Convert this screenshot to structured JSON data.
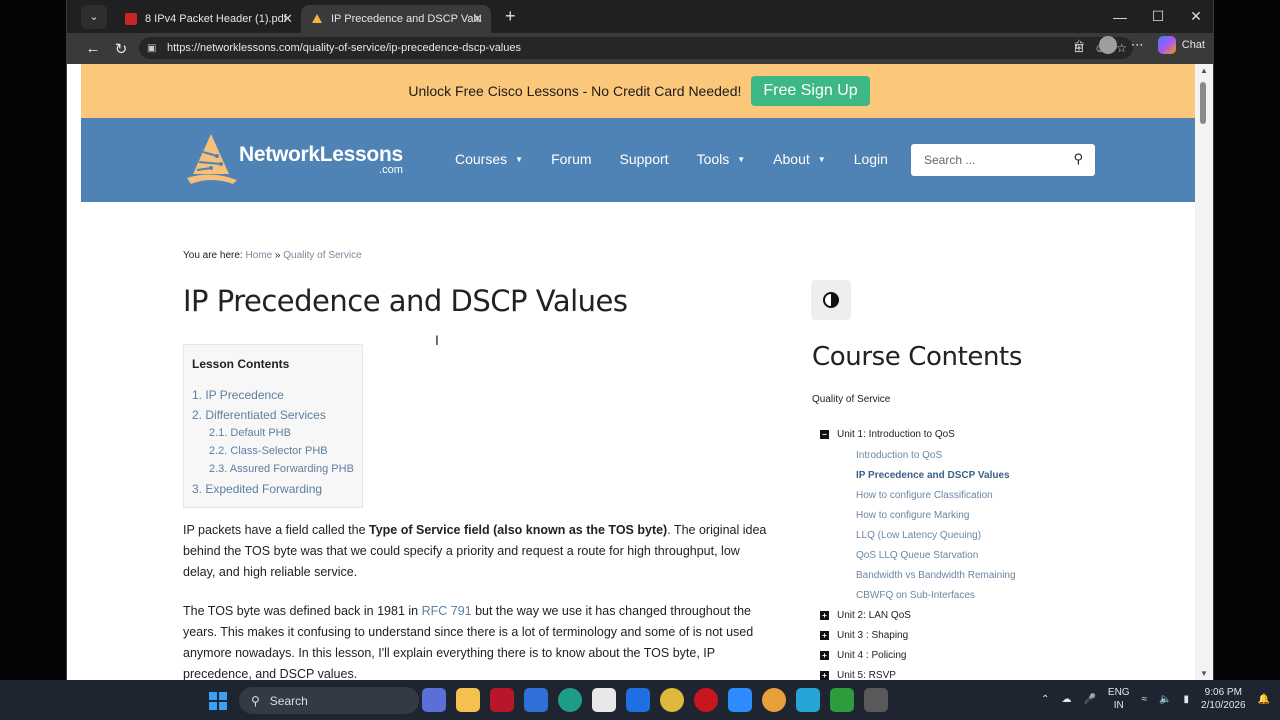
{
  "browser": {
    "tabs": [
      {
        "label": "8 IPv4 Packet Header (1).pdf"
      },
      {
        "label": "IP Precedence and DSCP Values"
      }
    ],
    "url": "https://networklessons.com/quality-of-service/ip-precedence-dscp-values",
    "chat_label": "Chat"
  },
  "promo": {
    "text": "Unlock Free Cisco Lessons - No Credit Card Needed!",
    "button": "Free Sign Up"
  },
  "site": {
    "logo_main": "NetworkLessons",
    "logo_sub": ".com",
    "nav": [
      {
        "label": "Courses",
        "dropdown": true
      },
      {
        "label": "Forum",
        "dropdown": false
      },
      {
        "label": "Support",
        "dropdown": false
      },
      {
        "label": "Tools",
        "dropdown": true
      },
      {
        "label": "About",
        "dropdown": true
      },
      {
        "label": "Login",
        "dropdown": false
      }
    ],
    "search_placeholder": "Search ..."
  },
  "article": {
    "breadcrumb_prefix": "You are here: ",
    "breadcrumb_home": "Home",
    "breadcrumb_sep": " » ",
    "breadcrumb_section": "Quality of Service",
    "title": "IP Precedence and DSCP Values",
    "toc_title": "Lesson Contents",
    "toc": [
      {
        "label": "1. IP Precedence",
        "sub": false
      },
      {
        "label": "2. Differentiated Services",
        "sub": false
      },
      {
        "label": "2.1. Default PHB",
        "sub": true
      },
      {
        "label": "2.2. Class-Selector PHB",
        "sub": true
      },
      {
        "label": "2.3. Assured Forwarding PHB",
        "sub": true
      },
      {
        "label": "3. Expedited Forwarding",
        "sub": false
      }
    ],
    "p1_a": "IP packets have a field called the ",
    "p1_bold": "Type of Service field (also known as the TOS byte)",
    "p1_b": ". The original idea behind the TOS byte was that we could specify a priority and request a route for high throughput, low delay, and high reliable service.",
    "p2_a": "The TOS byte was defined back in 1981 in ",
    "p2_link": "RFC 791",
    "p2_b": " but the way we use it has changed throughout the years. This makes it confusing to understand since there is a lot of terminology and some of is not used anymore nowadays. In this lesson, I'll explain everything there is to know about the TOS byte, IP precedence, and DSCP values."
  },
  "sidebar": {
    "title": "Course Contents",
    "course": "Quality of Service",
    "unit1": "Unit 1: Introduction to QoS",
    "lessons": [
      {
        "label": "Introduction to QoS",
        "active": false
      },
      {
        "label": "IP Precedence and DSCP Values",
        "active": true
      },
      {
        "label": "How to configure Classification",
        "active": false
      },
      {
        "label": "How to configure Marking",
        "active": false
      },
      {
        "label": "LLQ (Low Latency Queuing)",
        "active": false
      },
      {
        "label": "QoS LLQ Queue Starvation",
        "active": false
      },
      {
        "label": "Bandwidth vs Bandwidth Remaining",
        "active": false
      },
      {
        "label": "CBWFQ on Sub-Interfaces",
        "active": false
      }
    ],
    "units": [
      {
        "label": "Unit 2: LAN QoS"
      },
      {
        "label": "Unit 3 : Shaping"
      },
      {
        "label": "Unit 4 : Policing"
      },
      {
        "label": "Unit 5: RSVP"
      }
    ]
  },
  "taskbar": {
    "search": "Search",
    "lang_1": "ENG",
    "lang_2": "IN",
    "time": "9:06 PM",
    "date": "2/10/2026"
  },
  "colors": {
    "promo_bg": "#fbc77a",
    "promo_button": "#3db884",
    "nav_bg": "#4f82b5",
    "link": "#5d7fa0"
  }
}
